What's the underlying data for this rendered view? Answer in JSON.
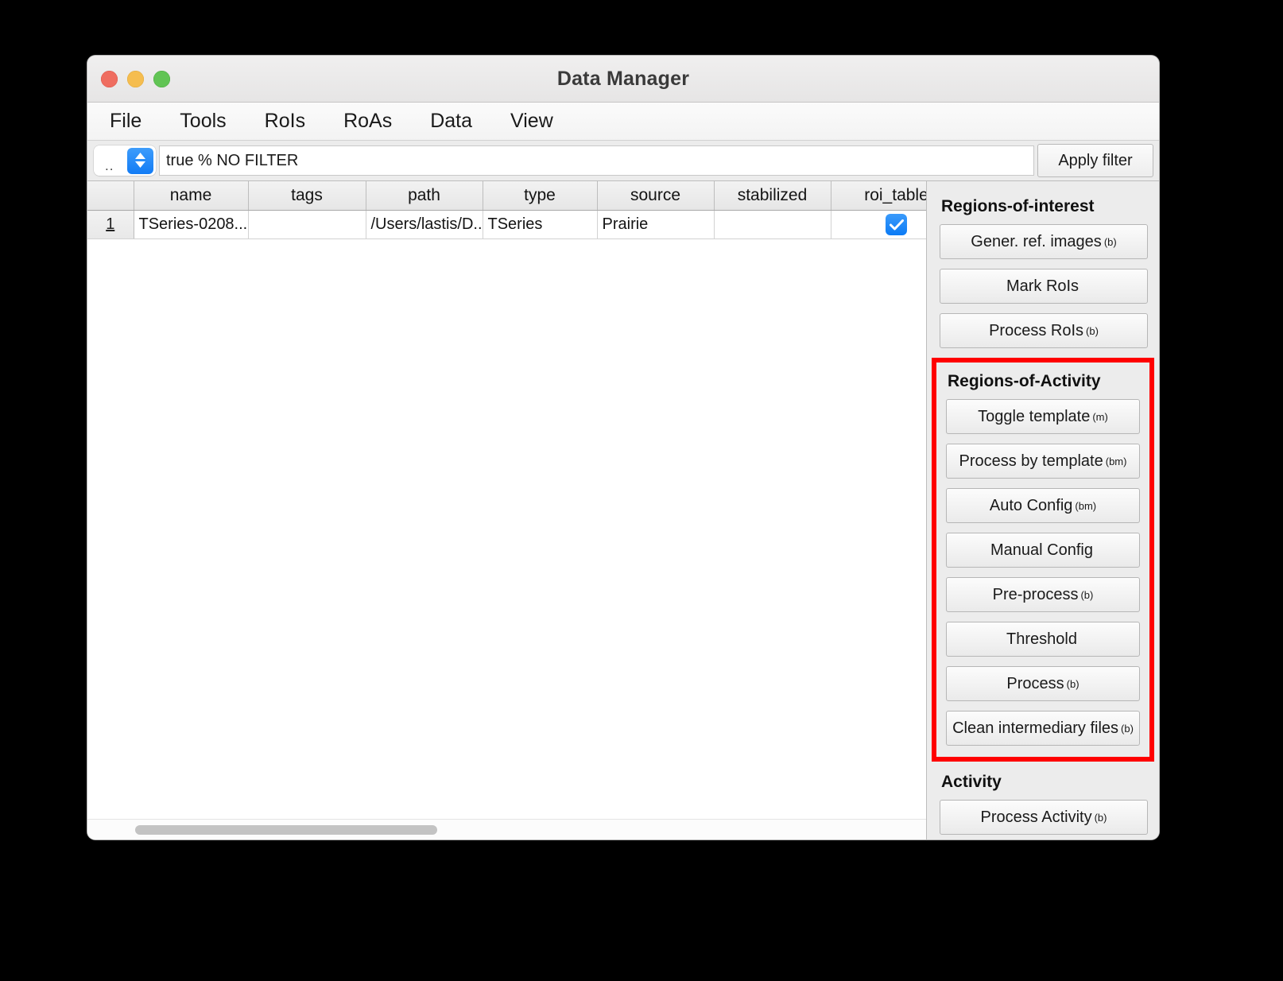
{
  "window": {
    "title": "Data Manager",
    "traffic_lights": [
      "close-button",
      "minimize-button",
      "zoom-button"
    ]
  },
  "menubar": {
    "items": [
      {
        "label": "File"
      },
      {
        "label": "Tools"
      },
      {
        "label": "RoIs"
      },
      {
        "label": "RoAs"
      },
      {
        "label": "Data"
      },
      {
        "label": "View"
      }
    ]
  },
  "filterbar": {
    "stepper_value": "..",
    "filter_value": "true % NO FILTER",
    "filter_placeholder": "",
    "apply_label": "Apply filter"
  },
  "table": {
    "columns": [
      "",
      "name",
      "tags",
      "path",
      "type",
      "source",
      "stabilized",
      "roi_table"
    ],
    "rows": [
      {
        "index": "1",
        "name": "TSeries-0208...",
        "tags": "",
        "path": "/Users/lastis/D...",
        "type": "TSeries",
        "source": "Prairie",
        "stabilized": "",
        "roi_table": true
      }
    ]
  },
  "sidebar": {
    "regions_of_interest": {
      "title": "Regions-of-interest",
      "buttons": [
        {
          "label": "Gener. ref. images",
          "sup": "(b)"
        },
        {
          "label": "Mark RoIs",
          "sup": ""
        },
        {
          "label": "Process RoIs",
          "sup": "(b)"
        }
      ]
    },
    "regions_of_activity": {
      "title": "Regions-of-Activity",
      "highlight_color": "#ff0000",
      "buttons": [
        {
          "label": "Toggle template",
          "sup": "(m)"
        },
        {
          "label": "Process by template",
          "sup": "(bm)"
        },
        {
          "label": "Auto Config",
          "sup": "(bm)"
        },
        {
          "label": "Manual Config",
          "sup": ""
        },
        {
          "label": "Pre-process",
          "sup": "(b)"
        },
        {
          "label": "Threshold",
          "sup": ""
        },
        {
          "label": "Process",
          "sup": "(b)"
        },
        {
          "label": "Clean intermediary files",
          "sup": "(b)"
        }
      ]
    },
    "activity": {
      "title": "Activity",
      "buttons": [
        {
          "label": "Process Activity",
          "sup": "(b)"
        }
      ]
    }
  }
}
